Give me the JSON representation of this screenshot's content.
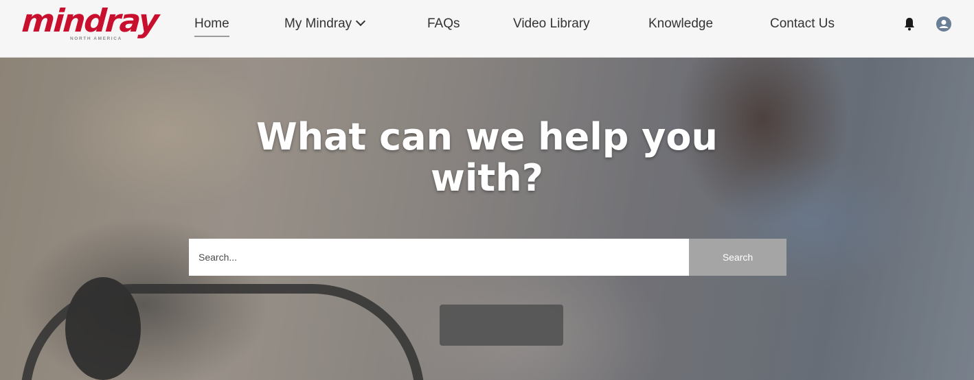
{
  "brand": {
    "logo_text": "mindray",
    "logo_subtext": "NORTH AMERICA",
    "color": "#c8102e"
  },
  "nav": {
    "items": [
      {
        "label": "Home",
        "active": true
      },
      {
        "label": "My Mindray",
        "has_dropdown": true
      },
      {
        "label": "FAQs"
      },
      {
        "label": "Video Library"
      },
      {
        "label": "Knowledge"
      },
      {
        "label": "Contact Us"
      }
    ],
    "icons": [
      "bell-icon",
      "user-avatar-icon"
    ]
  },
  "hero": {
    "title": "What can we help you with?",
    "search": {
      "placeholder": "Search...",
      "value": "",
      "button_label": "Search"
    }
  }
}
